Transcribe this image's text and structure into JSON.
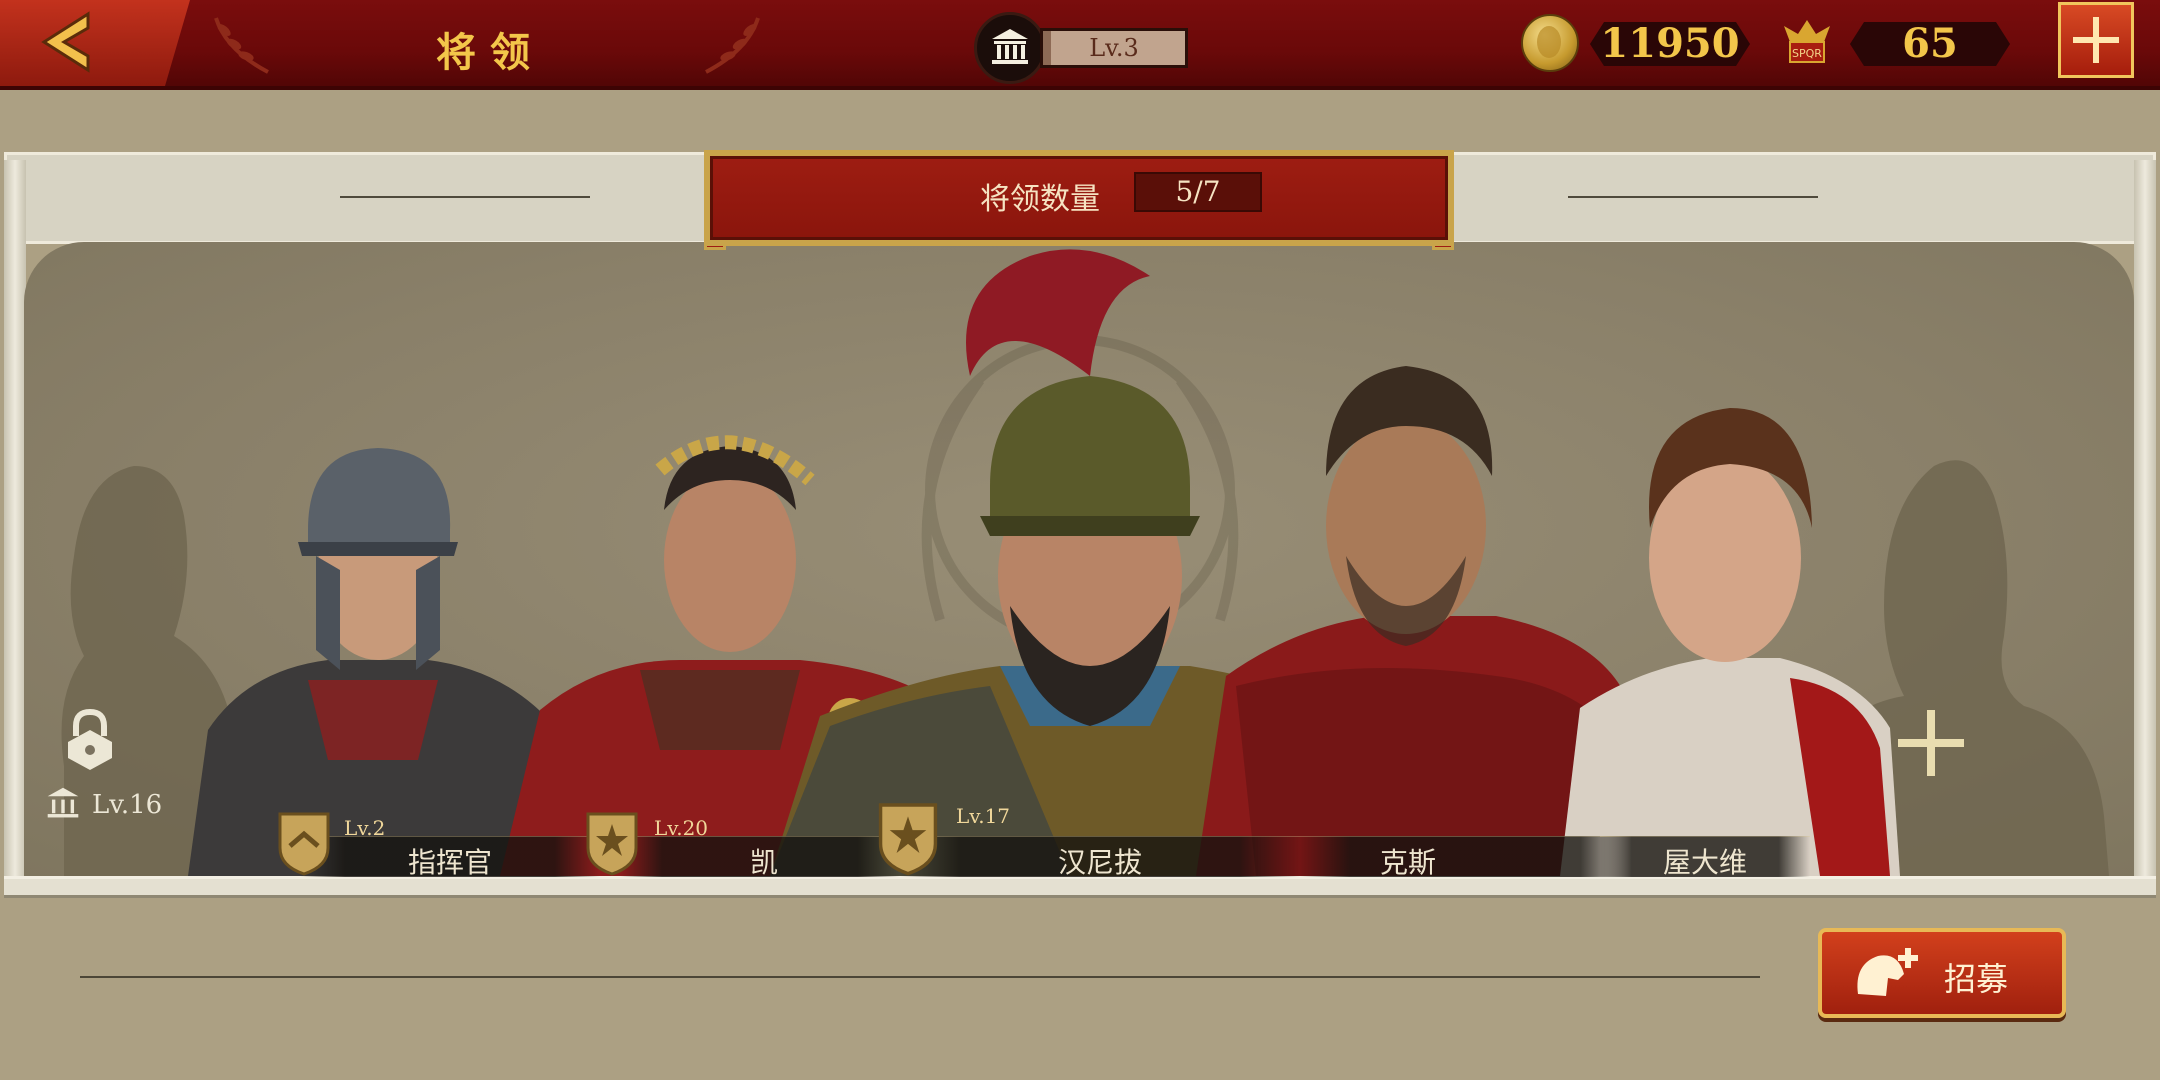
{
  "header": {
    "title": "将领",
    "building_level": "Lv.3",
    "gold": "11950",
    "spqr_count": "65",
    "spqr_icon_text": "SPQR"
  },
  "panel": {
    "count_label": "将领数量",
    "count_value": "5/7"
  },
  "locked_slot": {
    "unlock_level": "Lv.16"
  },
  "generals": [
    {
      "name": "指挥官",
      "level": "Lv.2",
      "rank": "chevron"
    },
    {
      "name": "凯",
      "level": "Lv.20",
      "rank": "star"
    },
    {
      "name": "汉尼拔",
      "level": "Lv.17",
      "rank": "star"
    },
    {
      "name": "克斯",
      "level": "",
      "rank": ""
    },
    {
      "name": "屋大维",
      "level": "",
      "rank": ""
    }
  ],
  "actions": {
    "recruit_label": "招募"
  },
  "colors": {
    "header_red": "#6a0909",
    "gold_text": "#f3c64a",
    "stage_bg": "#8a8069",
    "button_red": "#c0321a"
  }
}
